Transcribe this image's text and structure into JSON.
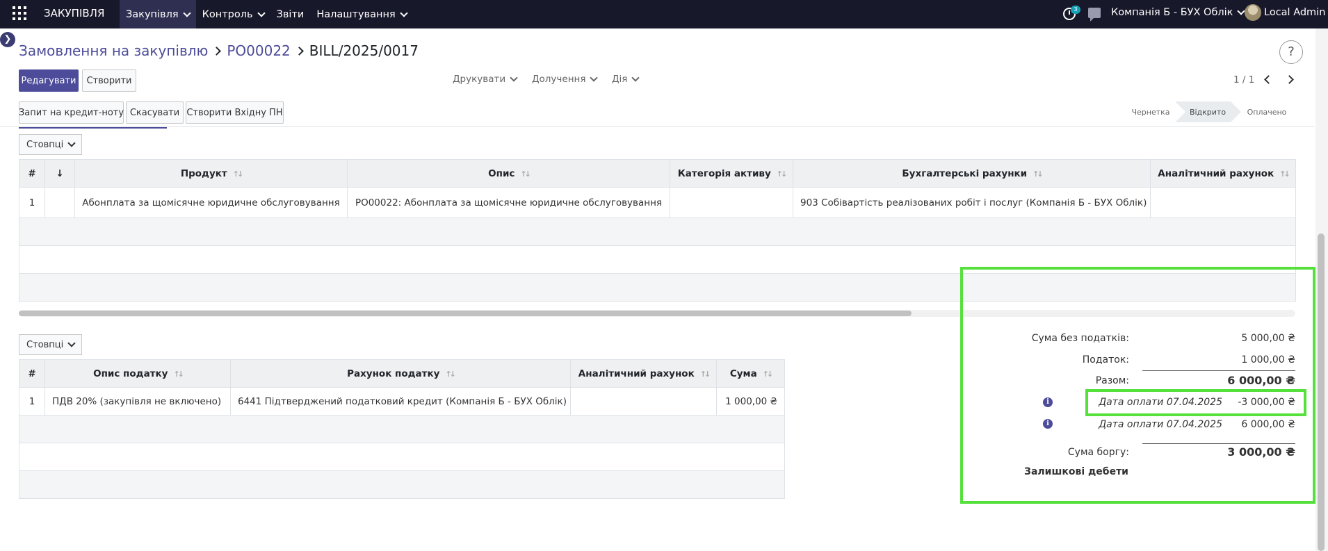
{
  "navbar": {
    "app_name": "ЗАКУПІВЛЯ",
    "menu": [
      "Закупівля",
      "Контроль",
      "Звіти",
      "Налаштування"
    ],
    "activity_count": "3",
    "company": "Компанія Б - БУХ Облік",
    "user": "Local Admin"
  },
  "breadcrumb": {
    "root": "Замовлення на закупівлю",
    "order": "PO00022",
    "current": "BILL/2025/0017"
  },
  "toolbar": {
    "edit": "Редагувати",
    "create": "Створити",
    "print": "Друкувати",
    "attach": "Долучення",
    "action": "Дія",
    "pager": "1 / 1",
    "help": "?"
  },
  "actions": {
    "credit_note": "Запит на кредит-ноту",
    "cancel": "Скасувати",
    "create_bill": "Створити Вхідну ПН"
  },
  "status": {
    "stages": [
      "Чернетка",
      "Відкрито",
      "Оплачено"
    ],
    "current": "Відкрито"
  },
  "lines_table": {
    "columns_button": "Стовпці",
    "headers": [
      "#",
      "↓",
      "Продукт",
      "Опис",
      "Категорія активу",
      "Бухгалтерські рахунки",
      "Аналітичний рахунок"
    ],
    "rows": [
      {
        "num": "1",
        "product": "Абонплата за щомісячне юридичне обслуговування",
        "description": "PO00022: Абонплата за щомісячне юридичне обслуговування",
        "asset_category": "",
        "account": "903 Собівартість реалізованих робіт і послуг (Компанія Б - БУХ Облік)",
        "analytic": ""
      }
    ]
  },
  "tax_table": {
    "columns_button": "Стовпці",
    "headers": [
      "#",
      "Опис податку",
      "Рахунок податку",
      "Аналітичний рахунок",
      "Сума"
    ],
    "rows": [
      {
        "num": "1",
        "tax": "ПДВ 20% (закупівля не включено)",
        "account": "6441 Підтверджений податковий кредит (Компанія Б - БУХ Облік)",
        "analytic": "",
        "amount": "1 000,00 ₴"
      }
    ]
  },
  "totals": {
    "untaxed_label": "Сума без податків:",
    "untaxed": "5 000,00 ₴",
    "tax_label": "Податок:",
    "tax": "1 000,00 ₴",
    "total_label": "Разом:",
    "total": "6 000,00 ₴",
    "payment1_label": "Дата оплати 07.04.2025",
    "payment1": "-3 000,00 ₴",
    "payment2_label": "Дата оплати 07.04.2025",
    "payment2": "6 000,00 ₴",
    "due_label": "Сума боргу:",
    "due": "3 000,00 ₴",
    "residual_label": "Залишкові дебети"
  },
  "colors": {
    "navbar": "#18182b",
    "primary": "#4c4c9a",
    "highlight": "#55e03c"
  }
}
